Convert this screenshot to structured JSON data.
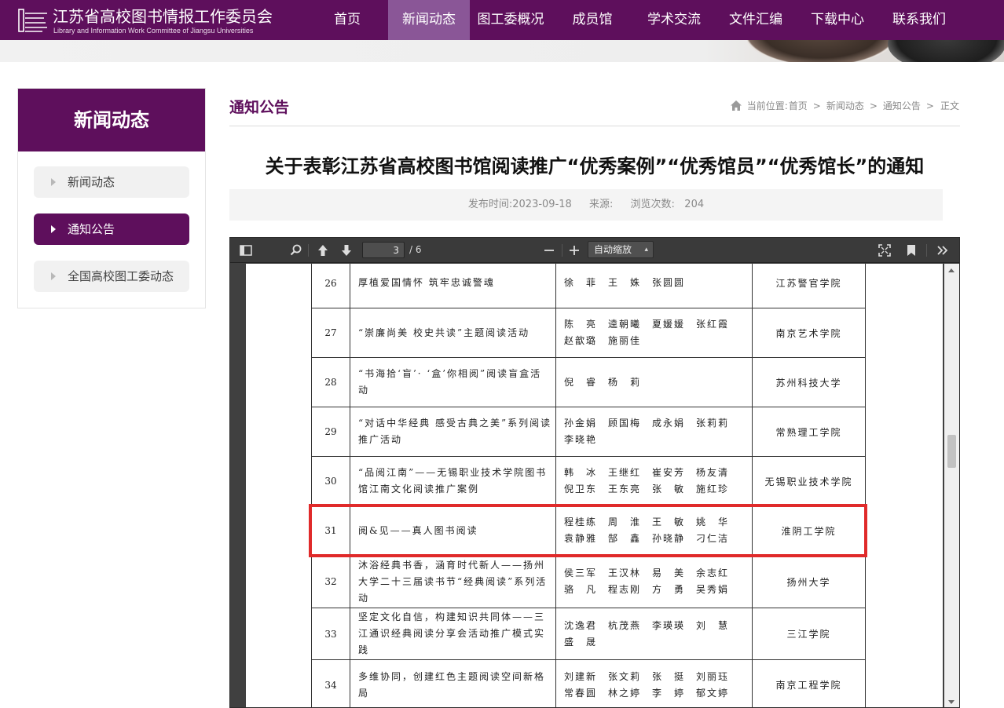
{
  "header": {
    "logo_cn": "江苏省高校图书情报工作委员会",
    "logo_en": "Library and Information Work Committee of Jiangsu Universities",
    "nav": [
      "首页",
      "新闻动态",
      "图工委概况",
      "成员馆",
      "学术交流",
      "文件汇编",
      "下载中心",
      "联系我们"
    ],
    "nav_active": "新闻动态"
  },
  "sidebar": {
    "title": "新闻动态",
    "items": [
      "新闻动态",
      "通知公告",
      "全国高校图工委动态"
    ],
    "active": "通知公告"
  },
  "section_title": "通知公告",
  "breadcrumb": {
    "prefix": "当前位置:",
    "items": [
      "首页",
      "新闻动态",
      "通知公告",
      "正文"
    ],
    "separator": ">"
  },
  "article": {
    "title": "关于表彰江苏省高校图书馆阅读推广“优秀案例”“优秀馆员”“优秀馆长”的通知",
    "publish_label": "发布时间:",
    "publish_date": "2023-09-18",
    "source_label": "来源:",
    "views_label": "浏览次数:",
    "views": "204"
  },
  "pdf_viewer": {
    "current_page": "3",
    "total_pages": "/ 6",
    "zoom": "自动缩放",
    "icons": [
      "sidebar-toggle-icon",
      "search-icon",
      "page-up-icon",
      "page-down-icon",
      "zoom-out-icon",
      "zoom-in-icon",
      "fullscreen-icon",
      "bookmark-icon",
      "more-tools-icon"
    ],
    "rows": [
      {
        "num": "26",
        "project": "厚植爱国情怀 筑牢忠诚警魂",
        "people": "徐　菲　王　姝　张圆圆",
        "org": "江苏警官学院"
      },
      {
        "num": "27",
        "project": "“崇廉尚美 校史共读”主题阅读活动",
        "people": "陈　亮　逵朝曦　夏媛媛　张红霞\n赵歆璐　施丽佳",
        "org": "南京艺术学院"
      },
      {
        "num": "28",
        "project": "“书海拾‘盲’· ‘盒’你相阅”阅读盲盒活动",
        "people": "倪　睿　杨　莉",
        "org": "苏州科技大学"
      },
      {
        "num": "29",
        "project": "“对话中华经典 感受古典之美”系列阅读推广活动",
        "people": "孙金娟　顾国梅　成永娟　张莉莉\n李晓艳",
        "org": "常熟理工学院"
      },
      {
        "num": "30",
        "project": "“品阅江南”——无锡职业技术学院图书馆江南文化阅读推广案例",
        "people": "韩　冰　王继红　崔安芳　杨友清\n倪卫东　王东亮　张　敏　施红珍",
        "org": "无锡职业技术学院"
      },
      {
        "num": "31",
        "project": "阅&见——真人图书阅读",
        "people": "程桂练　周　淮　王　敏　姚　华\n袁静雅　郜　鑫　孙晓静　刁仁洁",
        "org": "淮阴工学院"
      },
      {
        "num": "32",
        "project": "沐浴经典书香，涵育时代新人——扬州大学二十三届读书节“经典阅读”系列活动",
        "people": "侯三军　王汉林　易　美　余志红\n骆　凡　程志刚　方　勇　吴秀娟",
        "org": "扬州大学"
      },
      {
        "num": "33",
        "project": "坚定文化自信，构建知识共同体——三江通识经典阅读分享会活动推广模式实践",
        "people": "沈逸君　杭茂燕　李瑛瑛　刘　慧\n盛　晟",
        "org": "三江学院"
      },
      {
        "num": "34",
        "project": "多维协同，创建红色主题阅读空间新格局",
        "people": "刘建新　张文莉　张　挺　刘丽珏\n常春圆　林之婷　李　婷　郁文婷",
        "org": "南京工程学院"
      }
    ]
  },
  "colors": {
    "brand": "#5e0f5c",
    "nav_active": "#8a5697",
    "highlight": "#e02a2a"
  }
}
